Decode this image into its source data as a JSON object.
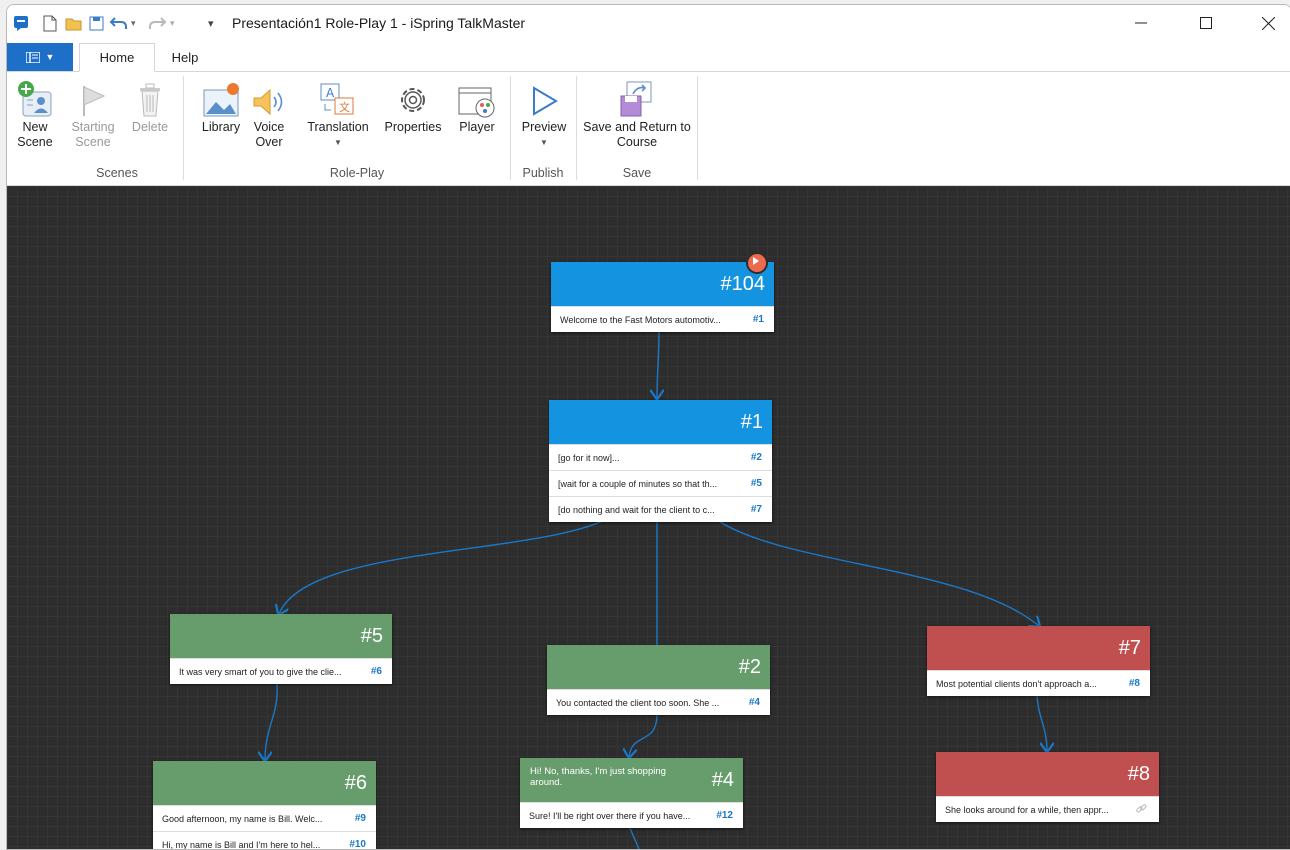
{
  "window": {
    "title": "Presentación1 Role-Play 1 - iSpring TalkMaster"
  },
  "tabs": {
    "file": "",
    "home": "Home",
    "help": "Help"
  },
  "ribbon": {
    "new_scene": "New Scene",
    "starting_scene": "Starting Scene",
    "delete": "Delete",
    "library": "Library",
    "voice_over": "Voice Over",
    "translation": "Translation",
    "properties": "Properties",
    "player": "Player",
    "preview": "Preview",
    "save_return": "Save and Return to Course",
    "groups": {
      "scenes": "Scenes",
      "roleplay": "Role-Play",
      "publish": "Publish",
      "save": "Save"
    }
  },
  "scenes": {
    "s104": {
      "id": "#104",
      "rows": [
        {
          "text": "Welcome to the Fast Motors automotiv...",
          "ref": "#1"
        }
      ]
    },
    "s1": {
      "id": "#1",
      "rows": [
        {
          "text": "[go for it now]...",
          "ref": "#2"
        },
        {
          "text": "[wait for a couple of minutes so that th...",
          "ref": "#5"
        },
        {
          "text": "[do nothing and wait for the client to c...",
          "ref": "#7"
        }
      ]
    },
    "s5": {
      "id": "#5",
      "rows": [
        {
          "text": "It was very smart of you to give the clie...",
          "ref": "#6"
        }
      ]
    },
    "s2": {
      "id": "#2",
      "rows": [
        {
          "text": "You contacted the client too soon. She ...",
          "ref": "#4"
        }
      ]
    },
    "s7": {
      "id": "#7",
      "rows": [
        {
          "text": "Most potential clients don't approach a...",
          "ref": "#8"
        }
      ]
    },
    "s6": {
      "id": "#6",
      "rows": [
        {
          "text": "Good afternoon, my name is Bill. Welc...",
          "ref": "#9"
        },
        {
          "text": "Hi, my name is Bill and I'm here to hel...",
          "ref": "#10"
        }
      ]
    },
    "s4": {
      "id": "#4",
      "head_text": "Hi! No, thanks, I'm just shopping around.",
      "rows": [
        {
          "text": "Sure! I'll be right over there if you have...",
          "ref": "#12"
        }
      ]
    },
    "s8": {
      "id": "#8",
      "rows": [
        {
          "text": "She looks around for a while, then appr...",
          "ref": ""
        }
      ]
    }
  },
  "colors": {
    "blue": "#1494e0",
    "green": "#679d6c",
    "red": "#c0504f",
    "link": "#1a78c8",
    "canvas": "#2d2d2d"
  }
}
